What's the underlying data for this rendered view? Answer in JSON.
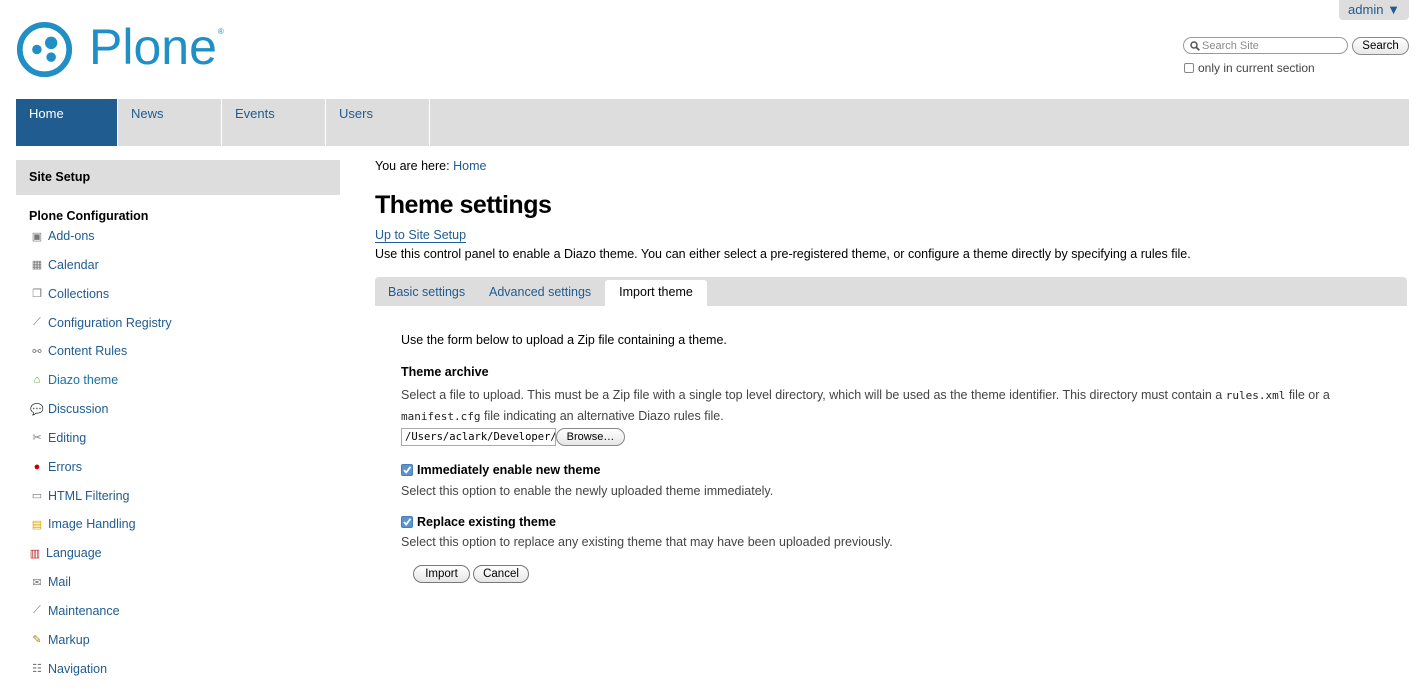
{
  "user_menu": {
    "label": "admin ▼"
  },
  "logo": {
    "text": "Plone",
    "registered": "®"
  },
  "search": {
    "placeholder": "Search Site",
    "button_label": "Search",
    "section_only_label": "only in current section"
  },
  "nav": {
    "tabs": [
      {
        "label": "Home"
      },
      {
        "label": "News"
      },
      {
        "label": "Events"
      },
      {
        "label": "Users"
      }
    ]
  },
  "sidebar": {
    "header": "Site Setup",
    "section_title": "Plone Configuration",
    "items": [
      {
        "label": "Add-ons",
        "icon": "addons-icon"
      },
      {
        "label": "Calendar",
        "icon": "calendar-icon"
      },
      {
        "label": "Collections",
        "icon": "collections-icon"
      },
      {
        "label": "Configuration Registry",
        "icon": "wrench-icon"
      },
      {
        "label": "Content Rules",
        "icon": "content-rules-icon"
      },
      {
        "label": "Diazo theme",
        "icon": "theme-icon"
      },
      {
        "label": "Discussion",
        "icon": "discussion-icon"
      },
      {
        "label": "Editing",
        "icon": "scissors-icon"
      },
      {
        "label": "Errors",
        "icon": "error-icon"
      },
      {
        "label": "HTML Filtering",
        "icon": "html-icon"
      },
      {
        "label": "Image Handling",
        "icon": "image-icon"
      },
      {
        "label": "Language",
        "icon": "flag-icon"
      },
      {
        "label": "Mail",
        "icon": "mail-icon"
      },
      {
        "label": "Maintenance",
        "icon": "wrench-icon"
      },
      {
        "label": "Markup",
        "icon": "pencil-icon"
      },
      {
        "label": "Navigation",
        "icon": "navigation-icon"
      }
    ]
  },
  "breadcrumb": {
    "prefix": "You are here:",
    "home": "Home"
  },
  "page": {
    "title": "Theme settings",
    "up_link": "Up to Site Setup",
    "description": "Use this control panel to enable a Diazo theme. You can either select a pre-registered theme, or configure a theme directly by specifying a rules file."
  },
  "form_tabs": [
    {
      "label": "Basic settings"
    },
    {
      "label": "Advanced settings"
    },
    {
      "label": "Import theme"
    }
  ],
  "form": {
    "intro": "Use the form below to upload a Zip file containing a theme.",
    "archive_label": "Theme archive",
    "archive_help_1": "Select a file to upload. This must be a Zip file with a single top level directory, which will be used as the theme identifier. This directory must contain a",
    "archive_help_code_1": "rules.xml",
    "archive_help_2": "file or a",
    "archive_help_code_2": "manifest.cfg",
    "archive_help_3": "file indicating an alternative Diazo rules file.",
    "file_value": "/Users/aclark/Developer/pl",
    "browse_label": "Browse…",
    "enable_label": "Immediately enable new theme",
    "enable_help": "Select this option to enable the newly uploaded theme immediately.",
    "replace_label": "Replace existing theme",
    "replace_help": "Select this option to replace any existing theme that may have been uploaded previously.",
    "import_label": "Import",
    "cancel_label": "Cancel"
  }
}
